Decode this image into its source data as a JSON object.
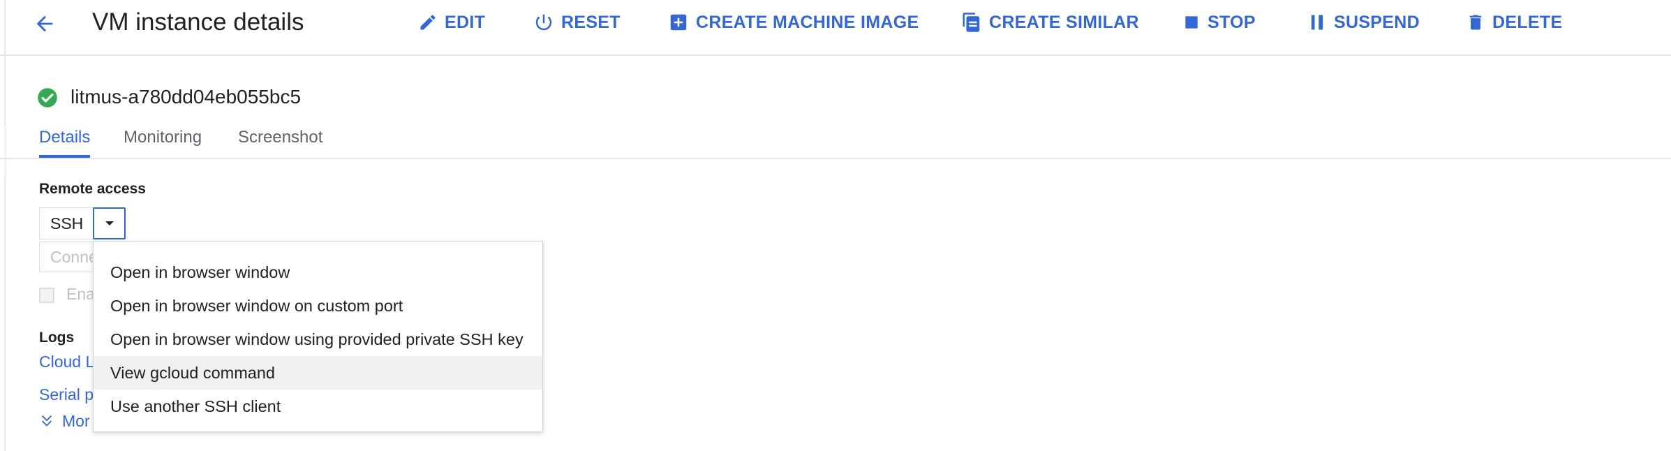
{
  "header": {
    "title": "VM instance details",
    "actions": [
      {
        "label": "EDIT",
        "icon": "pencil-icon"
      },
      {
        "label": "RESET",
        "icon": "power-icon"
      },
      {
        "label": "CREATE MACHINE IMAGE",
        "icon": "add-box-icon"
      },
      {
        "label": "CREATE SIMILAR",
        "icon": "copy-icon"
      },
      {
        "label": "STOP",
        "icon": "stop-icon"
      },
      {
        "label": "SUSPEND",
        "icon": "pause-icon"
      },
      {
        "label": "DELETE",
        "icon": "trash-icon"
      }
    ]
  },
  "instance": {
    "name": "litmus-a780dd04eb055bc5",
    "status_icon": "check-circle-icon",
    "status_color": "#34a853"
  },
  "tabs": [
    {
      "label": "Details",
      "active": true
    },
    {
      "label": "Monitoring",
      "active": false
    },
    {
      "label": "Screenshot",
      "active": false
    }
  ],
  "remote_access": {
    "label": "Remote access",
    "ssh_label": "SSH",
    "connect_placeholder": "Conne",
    "checkbox_label": "Ena"
  },
  "logs": {
    "label": "Logs",
    "cloud_link": "Cloud L",
    "serial_link": "Serial p",
    "more_link": "Mor"
  },
  "ssh_menu": {
    "items": [
      "Open in browser window",
      "Open in browser window on custom port",
      "Open in browser window using provided private SSH key",
      "View gcloud command",
      "Use another SSH client"
    ],
    "highlighted_index": 3
  },
  "colors": {
    "accent": "#3367d6",
    "text": "#202124",
    "muted": "#5f6368",
    "divider": "#e3e6ea"
  }
}
